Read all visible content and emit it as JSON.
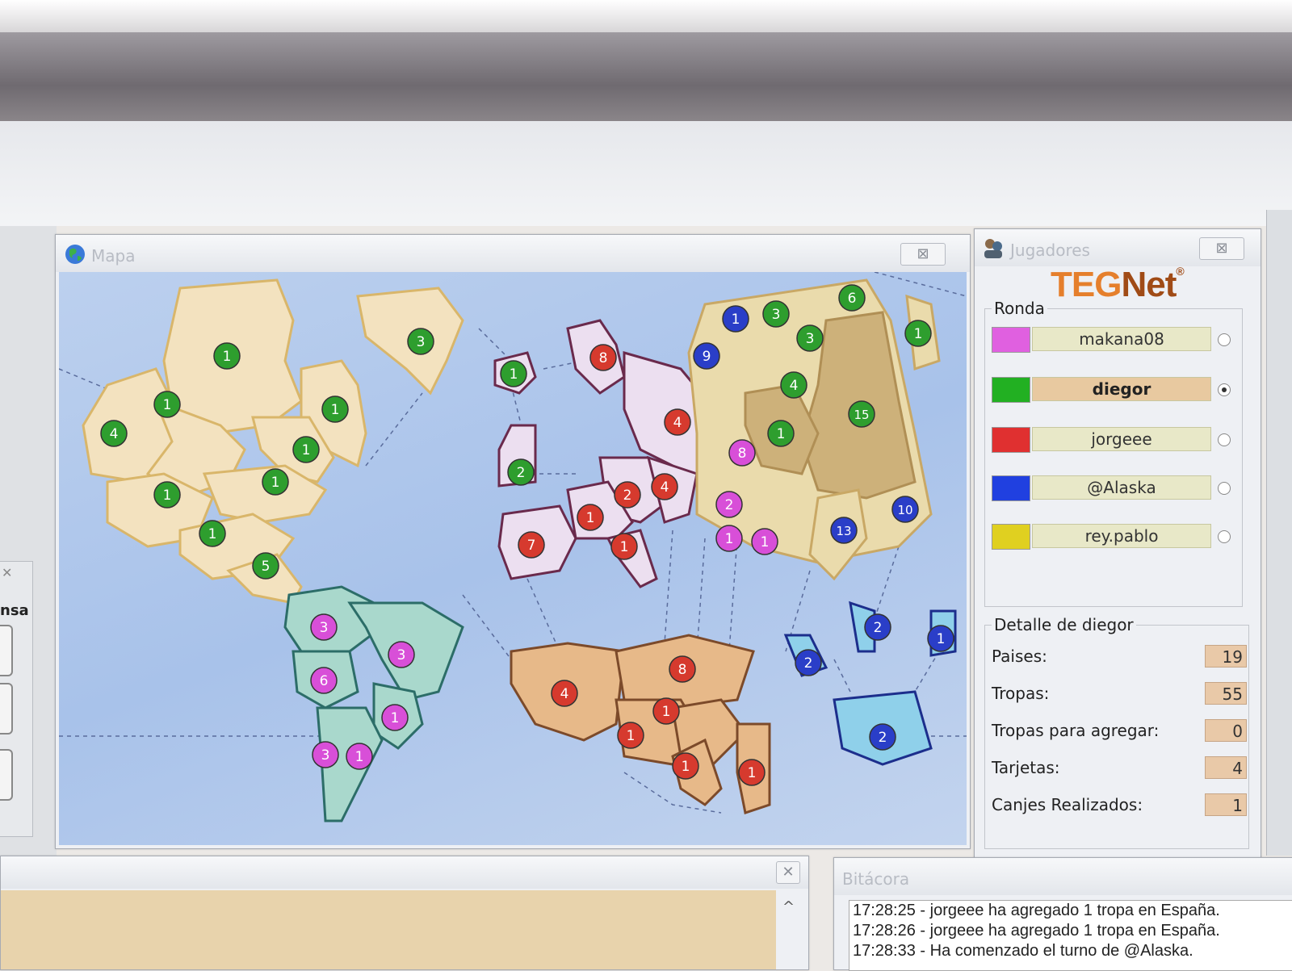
{
  "map_window": {
    "title": "Mapa",
    "close_glyph": "⊠"
  },
  "players_window": {
    "title": "Jugadores",
    "close_glyph": "⊠",
    "logo": {
      "teg": "TEG",
      "net": "Net",
      "reg": "®"
    },
    "round_label": "Ronda",
    "players": [
      {
        "name": "makana08",
        "color": "#e060e0",
        "active": false
      },
      {
        "name": "diegor",
        "color": "#22b022",
        "active": true
      },
      {
        "name": "jorgeee",
        "color": "#e03030",
        "active": false
      },
      {
        "name": "@Alaska",
        "color": "#2040e0",
        "active": false
      },
      {
        "name": "rey.pablo",
        "color": "#e0d020",
        "active": false
      }
    ],
    "detail_label": "Detalle de diegor",
    "details": [
      {
        "label": "Paises:",
        "value": "19"
      },
      {
        "label": "Tropas:",
        "value": "55"
      },
      {
        "label": "Tropas para agregar:",
        "value": "0"
      },
      {
        "label": "Tarjetas:",
        "value": "4"
      },
      {
        "label": "Canjes Realizados:",
        "value": "1"
      }
    ]
  },
  "left_panel": {
    "close_glyph": "✕",
    "label": "nsa"
  },
  "chat_window": {
    "close_glyph": "✕",
    "scroll_glyph": "^"
  },
  "log_window": {
    "title": "Bitácora",
    "lines": [
      "17:28:25 - jorgeee ha agregado 1 tropa en España.",
      "17:28:26 - jorgeee ha agregado 1 tropa en España.",
      "17:28:33 - Ha comenzado el turno de @Alaska."
    ]
  },
  "colors": {
    "green": "#2e9e2e",
    "red": "#d63a2e",
    "magenta": "#d84fd8",
    "blue": "#2a3ec8",
    "land_na": "#f3e2bf",
    "land_sa": "#a9d8cc",
    "land_eu": "#ecdff0",
    "land_af": "#e7b989",
    "land_as": "#eadbac",
    "land_as_dark": "#cdb17a",
    "land_oc": "#8fd0ea"
  },
  "map": {
    "markers": [
      {
        "v": "1",
        "c": "green"
      },
      {
        "v": "1",
        "c": "green"
      },
      {
        "v": "4",
        "c": "green"
      },
      {
        "v": "1",
        "c": "green"
      },
      {
        "v": "1",
        "c": "green"
      },
      {
        "v": "1",
        "c": "green"
      },
      {
        "v": "1",
        "c": "green"
      },
      {
        "v": "1",
        "c": "green"
      },
      {
        "v": "5",
        "c": "green"
      },
      {
        "v": "3",
        "c": "green"
      },
      {
        "v": "1",
        "c": "green"
      },
      {
        "v": "2",
        "c": "green"
      },
      {
        "v": "3",
        "c": "magenta"
      },
      {
        "v": "3",
        "c": "magenta"
      },
      {
        "v": "6",
        "c": "magenta"
      },
      {
        "v": "1",
        "c": "magenta"
      },
      {
        "v": "3",
        "c": "magenta"
      },
      {
        "v": "1",
        "c": "magenta"
      },
      {
        "v": "8",
        "c": "red"
      },
      {
        "v": "4",
        "c": "red"
      },
      {
        "v": "2",
        "c": "red"
      },
      {
        "v": "4",
        "c": "red"
      },
      {
        "v": "1",
        "c": "red"
      },
      {
        "v": "7",
        "c": "red"
      },
      {
        "v": "1",
        "c": "red"
      },
      {
        "v": "8",
        "c": "magenta"
      },
      {
        "v": "2",
        "c": "magenta"
      },
      {
        "v": "1",
        "c": "magenta"
      },
      {
        "v": "1",
        "c": "magenta"
      },
      {
        "v": "1",
        "c": "blue"
      },
      {
        "v": "9",
        "c": "blue"
      },
      {
        "v": "3",
        "c": "green"
      },
      {
        "v": "6",
        "c": "green"
      },
      {
        "v": "3",
        "c": "green"
      },
      {
        "v": "4",
        "c": "green"
      },
      {
        "v": "1",
        "c": "green"
      },
      {
        "v": "15",
        "c": "green"
      },
      {
        "v": "1",
        "c": "green"
      },
      {
        "v": "10",
        "c": "blue"
      },
      {
        "v": "13",
        "c": "blue"
      },
      {
        "v": "4",
        "c": "red"
      },
      {
        "v": "8",
        "c": "red"
      },
      {
        "v": "1",
        "c": "red"
      },
      {
        "v": "1",
        "c": "red"
      },
      {
        "v": "1",
        "c": "red"
      },
      {
        "v": "1",
        "c": "red"
      },
      {
        "v": "2",
        "c": "blue"
      },
      {
        "v": "2",
        "c": "blue"
      },
      {
        "v": "1",
        "c": "blue"
      },
      {
        "v": "2",
        "c": "blue"
      }
    ]
  }
}
